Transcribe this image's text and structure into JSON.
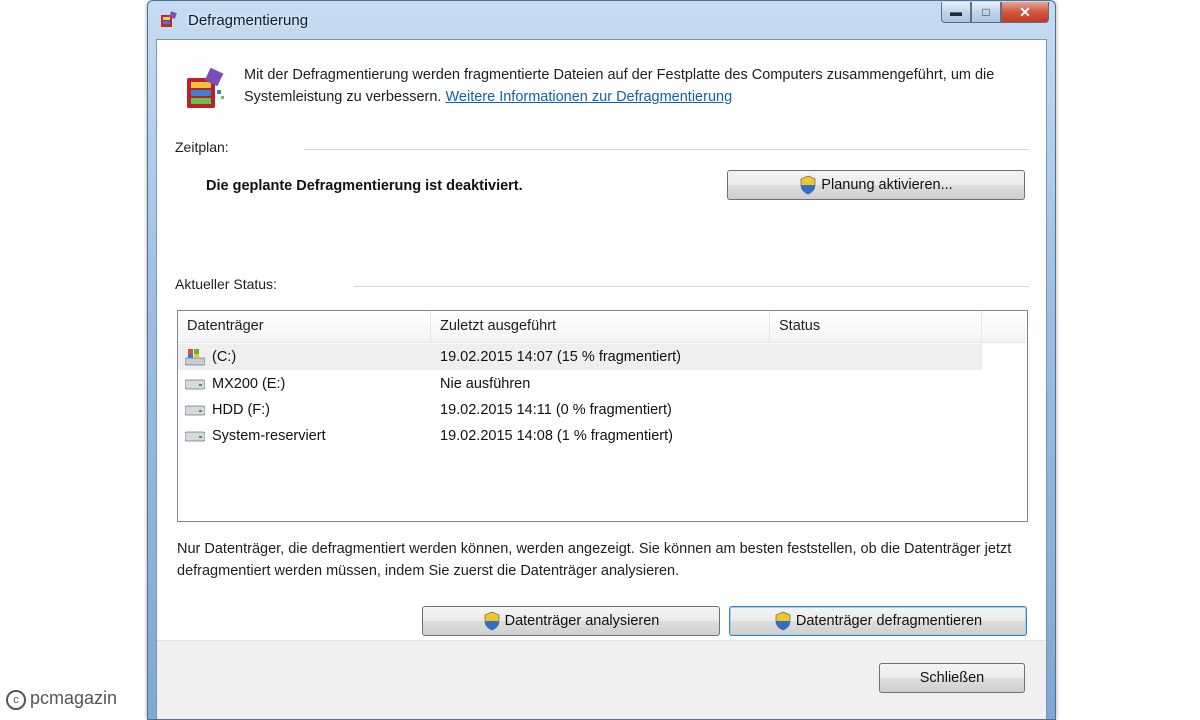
{
  "window": {
    "title": "Defragmentierung",
    "caption_buttons": {
      "minimize": "▬",
      "maximize": "□",
      "close": "✕"
    }
  },
  "intro": {
    "text": "Mit der Defragmentierung werden fragmentierte Dateien auf der Festplatte des Computers zusammengeführt, um die Systemleistung zu verbessern.",
    "link": "Weitere Informationen zur Defragmentierung",
    "icon": "defrag-app-icon"
  },
  "schedule": {
    "label": "Zeitplan:",
    "status": "Die geplante Defragmentierung ist deaktiviert.",
    "button": "Planung aktivieren..."
  },
  "status_section": {
    "label": "Aktueller Status:"
  },
  "table": {
    "columns": [
      "Datenträger",
      "Zuletzt ausgeführt",
      "Status"
    ],
    "rows": [
      {
        "icon": "system-drive-icon",
        "drive": "(C:)",
        "last_run": "19.02.2015 14:07 (15 % fragmentiert)",
        "status": ""
      },
      {
        "icon": "drive-icon",
        "drive": "MX200 (E:)",
        "last_run": "Nie ausführen",
        "status": ""
      },
      {
        "icon": "drive-icon",
        "drive": "HDD (F:)",
        "last_run": "19.02.2015 14:11 (0 % fragmentiert)",
        "status": ""
      },
      {
        "icon": "drive-icon",
        "drive": "System-reserviert",
        "last_run": "19.02.2015 14:08 (1 % fragmentiert)",
        "status": ""
      }
    ]
  },
  "note": "Nur Datenträger, die defragmentiert werden können, werden angezeigt. Sie können am besten feststellen, ob die Datenträger jetzt defragmentiert werden müssen, indem Sie zuerst die Datenträger analysieren.",
  "actions": {
    "analyze": "Datenträger analysieren",
    "defragment": "Datenträger defragmentieren",
    "close": "Schließen"
  },
  "watermark": "pcmagazin",
  "colors": {
    "link": "#0a63b8",
    "titlebar": "#9fc0e3",
    "close_button": "#c23a22"
  }
}
